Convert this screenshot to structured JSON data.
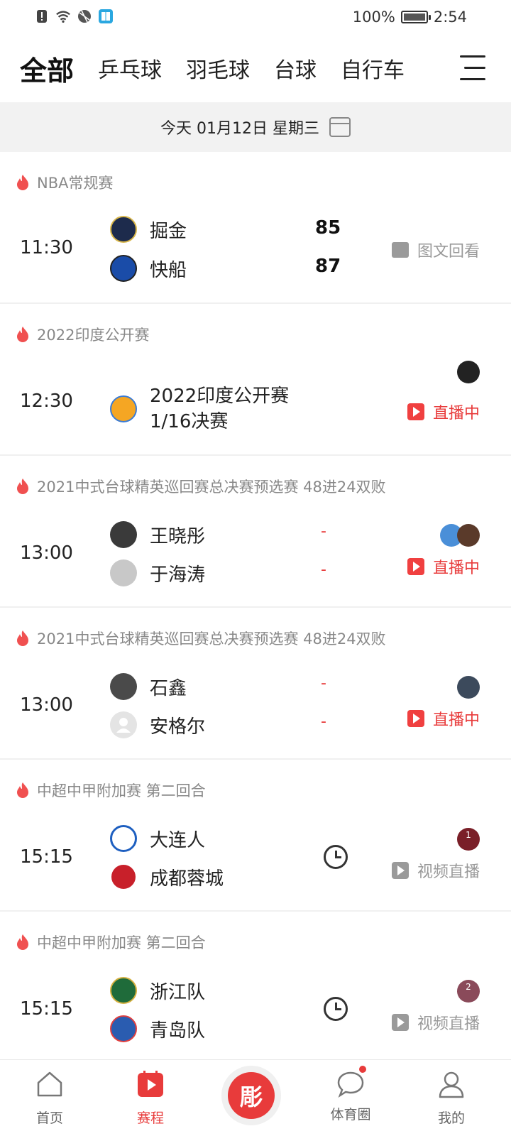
{
  "status_bar": {
    "battery": "100%",
    "time": "2:54"
  },
  "top_nav": {
    "tabs": [
      {
        "label": "全部",
        "active": true
      },
      {
        "label": "乒乓球",
        "active": false
      },
      {
        "label": "羽毛球",
        "active": false
      },
      {
        "label": "台球",
        "active": false
      },
      {
        "label": "自行车",
        "active": false
      }
    ]
  },
  "date_bar": {
    "text": "今天 01月12日 星期三"
  },
  "matches": [
    {
      "league": "NBA常规赛",
      "time": "11:30",
      "home": {
        "name": "掘金",
        "score": "85"
      },
      "away": {
        "name": "快船",
        "score": "87"
      },
      "status": "图文回看"
    },
    {
      "league": "2022印度公开赛",
      "time": "12:30",
      "title_line1": "2022印度公开赛",
      "title_line2": "1/16决赛",
      "status": "直播中"
    },
    {
      "league": "2021中式台球精英巡回赛总决赛预选赛 48进24双败",
      "time": "13:00",
      "home": {
        "name": "王晓彤",
        "score": "-"
      },
      "away": {
        "name": "于海涛",
        "score": "-"
      },
      "status": "直播中"
    },
    {
      "league": "2021中式台球精英巡回赛总决赛预选赛 48进24双败",
      "time": "13:00",
      "home": {
        "name": "石鑫",
        "score": "-"
      },
      "away": {
        "name": "安格尔",
        "score": "-"
      },
      "status": "直播中"
    },
    {
      "league": "中超中甲附加赛 第二回合",
      "time": "15:15",
      "home": {
        "name": "大连人"
      },
      "away": {
        "name": "成都蓉城"
      },
      "status": "视频直播",
      "badge": "1"
    },
    {
      "league": "中超中甲附加赛 第二回合",
      "time": "15:15",
      "home": {
        "name": "浙江队"
      },
      "away": {
        "name": "青岛队"
      },
      "status": "视频直播",
      "badge": "2"
    }
  ],
  "bottom_nav": {
    "home": "首页",
    "schedule": "赛程",
    "center": "彫",
    "community": "体育圈",
    "mine": "我的"
  },
  "colors": {
    "accent": "#e83b3b",
    "muted": "#999999"
  }
}
